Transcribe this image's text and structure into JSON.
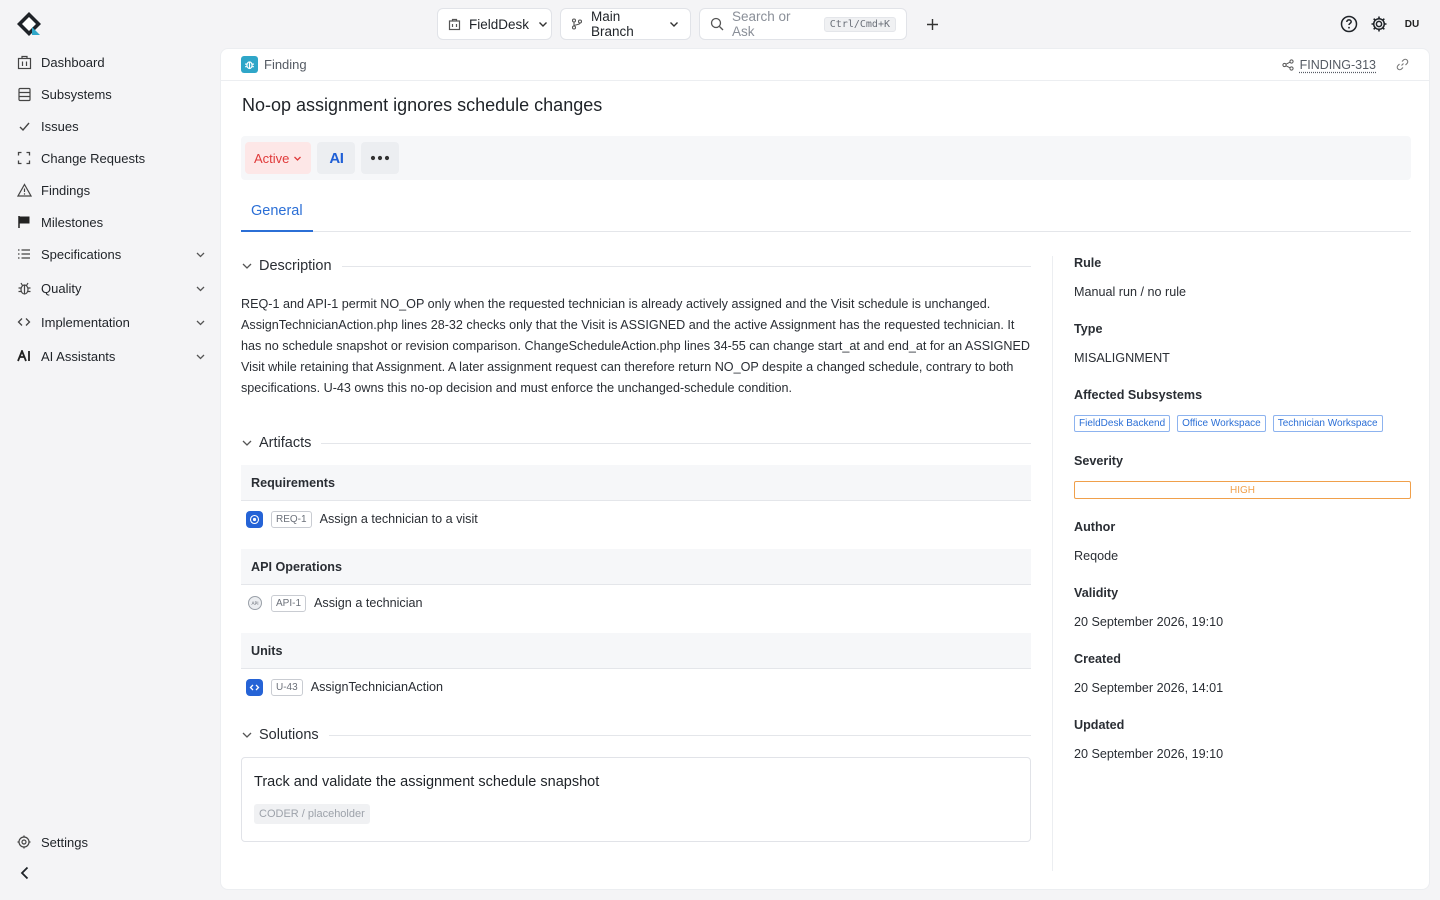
{
  "topbar": {
    "project": "FieldDesk",
    "branch": "Main Branch",
    "search_placeholder": "Search or Ask",
    "search_shortcut": "Ctrl/Cmd+K",
    "user_initials": "DU"
  },
  "sidebar": {
    "items": [
      {
        "label": "Dashboard",
        "icon": "dashboard-icon"
      },
      {
        "label": "Subsystems",
        "icon": "subsystems-icon"
      },
      {
        "label": "Issues",
        "icon": "check-icon"
      },
      {
        "label": "Change Requests",
        "icon": "change-requests-icon"
      },
      {
        "label": "Findings",
        "icon": "warning-icon"
      },
      {
        "label": "Milestones",
        "icon": "flag-icon"
      },
      {
        "label": "Specifications",
        "icon": "list-icon",
        "expandable": true
      },
      {
        "label": "Quality",
        "icon": "bug-icon",
        "expandable": true
      },
      {
        "label": "Implementation",
        "icon": "code-icon",
        "expandable": true
      },
      {
        "label": "AI Assistants",
        "icon": "ai-icon",
        "expandable": true
      }
    ],
    "settings_label": "Settings"
  },
  "finding": {
    "type_label": "Finding",
    "id": "FINDING-313",
    "title": "No-op assignment ignores schedule changes",
    "status": "Active",
    "ai_label": "AI",
    "tabs": [
      "General"
    ],
    "description_heading": "Description",
    "description": "REQ-1 and API-1 permit NO_OP only when the requested technician is already actively assigned and the Visit schedule is unchanged. AssignTechnicianAction.php lines 28-32 checks only that the Visit is ASSIGNED and the active Assignment has the requested technician. It has no schedule snapshot or revision comparison. ChangeScheduleAction.php lines 34-55 can change start_at and end_at for an ASSIGNED Visit while retaining that Assignment. A later assignment request can therefore return NO_OP despite a changed schedule, contrary to both specifications. U-43 owns this no-op decision and must enforce the unchanged-schedule condition.",
    "artifacts_heading": "Artifacts",
    "artifact_groups": [
      {
        "heading": "Requirements",
        "items": [
          {
            "tag": "REQ-1",
            "label": "Assign a technician to a visit"
          }
        ]
      },
      {
        "heading": "API Operations",
        "items": [
          {
            "tag": "API-1",
            "label": "Assign a technician"
          }
        ]
      },
      {
        "heading": "Units",
        "items": [
          {
            "tag": "U-43",
            "label": "AssignTechnicianAction"
          }
        ]
      }
    ],
    "solutions_heading": "Solutions",
    "solution": {
      "title": "Track and validate the assignment schedule snapshot",
      "tag": "CODER / placeholder"
    },
    "properties": {
      "rule_label": "Rule",
      "rule": "Manual run / no rule",
      "type_label": "Type",
      "type": "MISALIGNMENT",
      "subsystems_label": "Affected Subsystems",
      "subsystems": [
        "FieldDesk Backend",
        "Office Workspace",
        "Technician Workspace"
      ],
      "severity_label": "Severity",
      "severity": "HIGH",
      "author_label": "Author",
      "author": "Reqode",
      "validity_label": "Validity",
      "validity": "20 September 2026, 19:10",
      "created_label": "Created",
      "created": "20 September 2026, 14:01",
      "updated_label": "Updated",
      "updated": "20 September 2026, 19:10"
    }
  },
  "colors": {
    "accent": "#2b6fd6",
    "status_active": "#e03a3a",
    "severity_high": "#f0a04b",
    "finding_icon": "#2fa6c8"
  }
}
